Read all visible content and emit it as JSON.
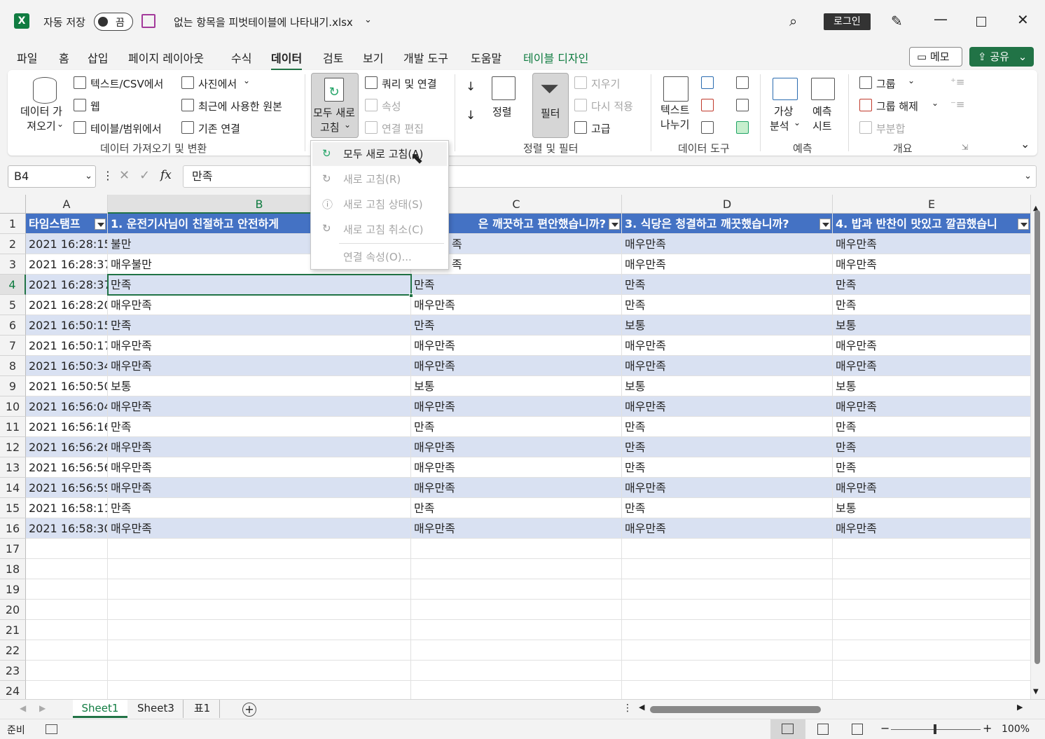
{
  "titlebar": {
    "autosave_label": "자동 저장",
    "autosave_state": "끔",
    "filename": "없는 항목을 피벗테이블에 나타내기.xlsx",
    "login": "로그인"
  },
  "tabs": [
    "파일",
    "홈",
    "삽입",
    "페이지 레이아웃",
    "수식",
    "데이터",
    "검토",
    "보기",
    "개발 도구",
    "도움말",
    "테이블 디자인"
  ],
  "active_tab": "데이터",
  "memo_label": "메모",
  "share_label": "공유",
  "ribbon": {
    "get_data": "데이터 가\n져오기",
    "text_csv": "텍스트/CSV에서",
    "web": "웹",
    "table_range": "테이블/범위에서",
    "from_picture": "사진에서",
    "recent_sources": "최근에 사용한 원본",
    "existing_conn": "기존 연결",
    "group_get": "데이터 가져오기 및 변환",
    "refresh_all": "모두 새로",
    "refresh_all_2": "고침",
    "queries_conn": "쿼리 및 연결",
    "properties": "속성",
    "edit_links": "연결 편집",
    "sort": "정렬",
    "filter": "필터",
    "clear": "지우기",
    "reapply": "다시 적용",
    "advanced": "고급",
    "group_sort": "정렬 및 필터",
    "text_to_cols": "텍스트",
    "text_to_cols_2": "나누기",
    "group_tools": "데이터 도구",
    "whatif": "가상",
    "whatif_2": "분석",
    "forecast": "예측",
    "forecast_2": "시트",
    "group_forecast": "예측",
    "group_btn": "그룹",
    "ungroup": "그룹 해제",
    "subtotal": "부분합",
    "group_outline": "개요"
  },
  "dropdown": {
    "items": [
      {
        "label": "모두 새로 고침(A)",
        "enabled": true
      },
      {
        "label": "새로 고침(R)",
        "enabled": false
      },
      {
        "label": "새로 고침 상태(S)",
        "enabled": false
      },
      {
        "label": "새로 고침 취소(C)",
        "enabled": false
      },
      {
        "label": "연결 속성(O)...",
        "enabled": false
      }
    ]
  },
  "formula_bar": {
    "name_box": "B4",
    "fx": "fx",
    "value": "만족"
  },
  "columns": [
    "A",
    "B",
    "C",
    "D",
    "E"
  ],
  "selected_column": "B",
  "selected_row": 4,
  "table_header": [
    "타임스탬프",
    "1. 운전기사님이 친절하고 안전하게",
    "은 깨끗하고 편안했습니까?",
    "3. 식당은 청결하고 깨끗했습니까?",
    "4. 밥과 반찬이 맛있고 깔끔했습니"
  ],
  "rows": [
    [
      "2021 16:28:15",
      "불만",
      "족",
      "매우만족",
      "매우만족"
    ],
    [
      "2021 16:28:37",
      "매우불만",
      "족",
      "매우만족",
      "매우만족"
    ],
    [
      "2021 16:28:37",
      "만족",
      "만족",
      "만족",
      "만족"
    ],
    [
      "2021 16:28:20",
      "매우만족",
      "매우만족",
      "만족",
      "만족"
    ],
    [
      "2021 16:50:15",
      "만족",
      "만족",
      "보통",
      "보통"
    ],
    [
      "2021 16:50:17",
      "매우만족",
      "매우만족",
      "매우만족",
      "매우만족"
    ],
    [
      "2021 16:50:34",
      "매우만족",
      "매우만족",
      "매우만족",
      "매우만족"
    ],
    [
      "2021 16:50:50",
      "보통",
      "보통",
      "보통",
      "보통"
    ],
    [
      "2021 16:56:04",
      "매우만족",
      "매우만족",
      "매우만족",
      "매우만족"
    ],
    [
      "2021 16:56:16",
      "만족",
      "만족",
      "만족",
      "만족"
    ],
    [
      "2021 16:56:26",
      "매우만족",
      "매우만족",
      "만족",
      "만족"
    ],
    [
      "2021 16:56:56",
      "매우만족",
      "매우만족",
      "만족",
      "만족"
    ],
    [
      "2021 16:56:59",
      "매우만족",
      "매우만족",
      "매우만족",
      "매우만족"
    ],
    [
      "2021 16:58:11",
      "만족",
      "만족",
      "만족",
      "보통"
    ],
    [
      "2021 16:58:30",
      "매우만족",
      "매우만족",
      "매우만족",
      "매우만족"
    ]
  ],
  "row_numbers": [
    1,
    2,
    3,
    4,
    5,
    6,
    7,
    8,
    9,
    10,
    11,
    12,
    13,
    14,
    15,
    16,
    17,
    18,
    19,
    20,
    21,
    22,
    23,
    24
  ],
  "sheets": [
    "Sheet1",
    "Sheet3",
    "표1"
  ],
  "active_sheet": "Sheet1",
  "status": {
    "ready": "준비",
    "zoom": "100%"
  },
  "colors": {
    "accent": "#217346",
    "table_header": "#4472c4",
    "band": "#d9e1f2"
  }
}
